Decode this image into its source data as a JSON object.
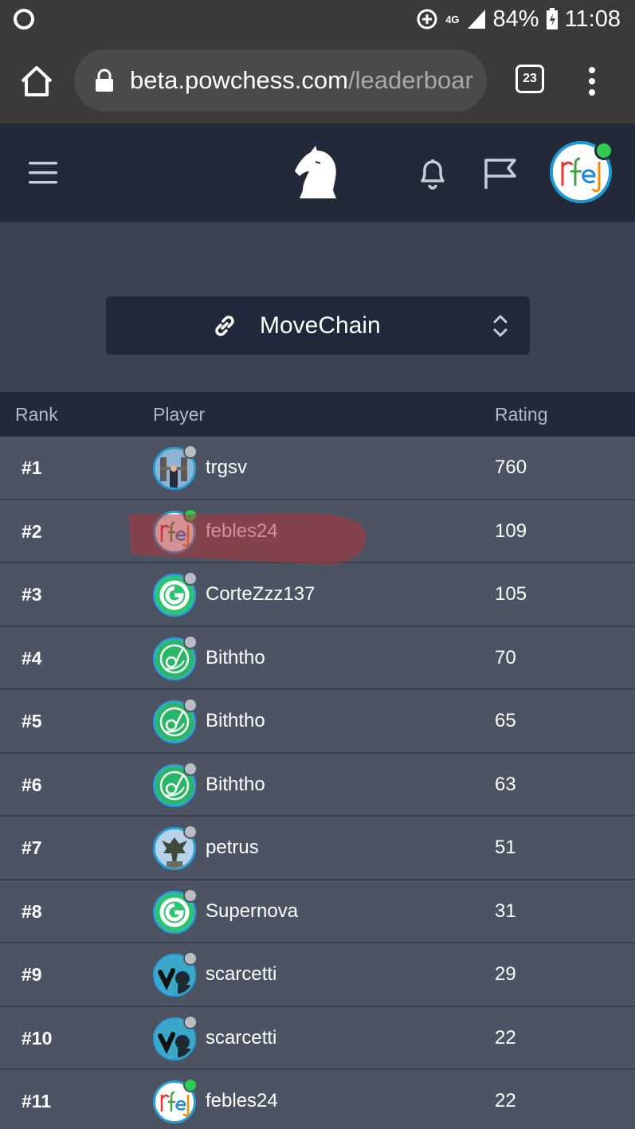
{
  "status_bar": {
    "network": "4G",
    "battery": "84%",
    "time": "11:08"
  },
  "browser": {
    "url_host": "beta.powchess.com",
    "url_path": "/leaderboar",
    "tab_count": "23"
  },
  "header": {
    "user_status": "online"
  },
  "selector": {
    "label": "MoveChain"
  },
  "table": {
    "columns": [
      "Rank",
      "Player",
      "Rating"
    ],
    "rows": [
      {
        "rank": "#1",
        "name": "trgsv",
        "rating": "760",
        "avatar": "photo-tower",
        "status": "offline"
      },
      {
        "rank": "#2",
        "name": "febles24",
        "rating": "109",
        "avatar": "rfej",
        "status": "online"
      },
      {
        "rank": "#3",
        "name": "CorteZzz137",
        "rating": "105",
        "avatar": "green-c",
        "status": "offline"
      },
      {
        "rank": "#4",
        "name": "Biththo",
        "rating": "70",
        "avatar": "green-swirl",
        "status": "offline"
      },
      {
        "rank": "#5",
        "name": "Biththo",
        "rating": "65",
        "avatar": "green-swirl",
        "status": "offline"
      },
      {
        "rank": "#6",
        "name": "Biththo",
        "rating": "63",
        "avatar": "green-swirl",
        "status": "offline"
      },
      {
        "rank": "#7",
        "name": "petrus",
        "rating": "51",
        "avatar": "dragon",
        "status": "offline"
      },
      {
        "rank": "#8",
        "name": "Supernova",
        "rating": "31",
        "avatar": "green-c",
        "status": "offline"
      },
      {
        "rank": "#9",
        "name": "scarcetti",
        "rating": "29",
        "avatar": "dark-hand",
        "status": "offline"
      },
      {
        "rank": "#10",
        "name": "scarcetti",
        "rating": "22",
        "avatar": "dark-hand",
        "status": "offline"
      },
      {
        "rank": "#11",
        "name": "febles24",
        "rating": "22",
        "avatar": "rfej",
        "status": "online"
      }
    ]
  },
  "colors": {
    "header_bg": "#222a3a",
    "page_bg": "#3b4254",
    "row_bg": "#4c5464",
    "online": "#2ecc54",
    "offline": "#b9bcc3",
    "highlight_marker": "#b0343a"
  }
}
